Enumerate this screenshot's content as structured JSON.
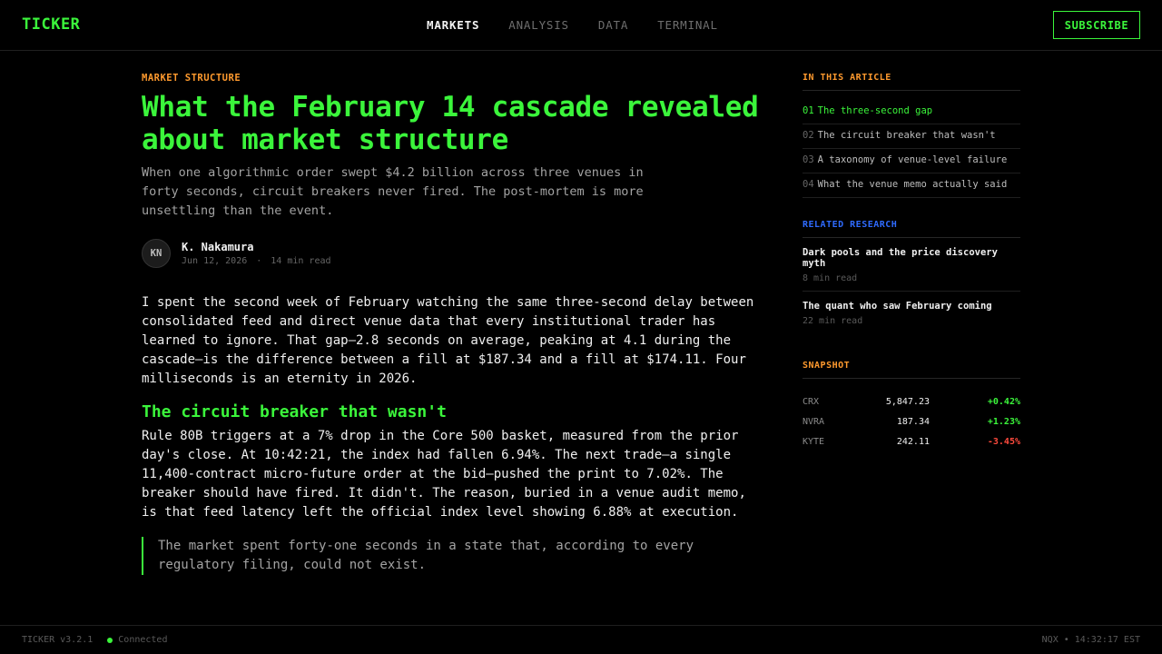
{
  "header": {
    "logo": "TICKER",
    "nav": [
      "MARKETS",
      "ANALYSIS",
      "DATA",
      "TERMINAL"
    ],
    "subscribe_label": "SUBSCRIBE"
  },
  "article": {
    "kicker": "MARKET STRUCTURE",
    "headline": "What the February 14 cascade revealed about market structure",
    "dek": "When one algorithmic order swept $4.2 billion across three venues in forty seconds, circuit breakers never fired. The post-mortem is more unsettling than the event.",
    "author_initials": "KN",
    "author": "K. Nakamura",
    "date": "Jun 12, 2026",
    "separator": "·",
    "read_time": "14 min read",
    "paragraph1": "I spent the second week of February watching the same three-second delay between consolidated feed and direct venue data that every institutional trader has learned to ignore. That gap—2.8 seconds on average, peaking at 4.1 during the cascade—is the difference between a fill at $187.34 and a fill at $174.11. Four milliseconds is an eternity in 2026.",
    "subhead": "The circuit breaker that wasn't",
    "paragraph2": "Rule 80B triggers at a 7% drop in the Core 500 basket, measured from the prior day's close. At 10:42:21, the index had fallen 6.94%. The next trade—a single 11,400-contract micro-future order at the bid—pushed the print to 7.02%. The breaker should have fired. It didn't. The reason, buried in a venue audit memo, is that feed latency left the official index level showing 6.88% at execution.",
    "quote": "The market spent forty-one seconds in a state that, according to every regulatory filing, could not exist."
  },
  "sidebar": {
    "toc_title": "IN THIS ARTICLE",
    "toc": [
      {
        "num": "01",
        "label": "The three-second gap"
      },
      {
        "num": "02",
        "label": "The circuit breaker that wasn't"
      },
      {
        "num": "03",
        "label": "A taxonomy of venue-level failure"
      },
      {
        "num": "04",
        "label": "What the venue memo actually said"
      }
    ],
    "related_title": "RELATED RESEARCH",
    "related": [
      {
        "title": "Dark pools and the price discovery myth",
        "time": "8 min read"
      },
      {
        "title": "The quant who saw February coming",
        "time": "22 min read"
      }
    ],
    "snapshot_title": "SNAPSHOT",
    "snapshot": [
      {
        "sym": "CRX",
        "price": "5,847.23",
        "chg": "+0.42%"
      },
      {
        "sym": "NVRA",
        "price": "187.34",
        "chg": "+1.23%"
      },
      {
        "sym": "KYTE",
        "price": "242.11",
        "chg": "-3.45%"
      }
    ]
  },
  "footer": {
    "version": "TICKER v3.2.1",
    "status": "Connected",
    "exchange": "NQX",
    "separator": "•",
    "time": "14:32:17 EST"
  },
  "colors": {
    "accent_green": "#3bf53b",
    "accent_orange": "#ff9a2e",
    "accent_blue": "#2f6bff",
    "negative_red": "#ff4a3d",
    "background": "#000000"
  }
}
